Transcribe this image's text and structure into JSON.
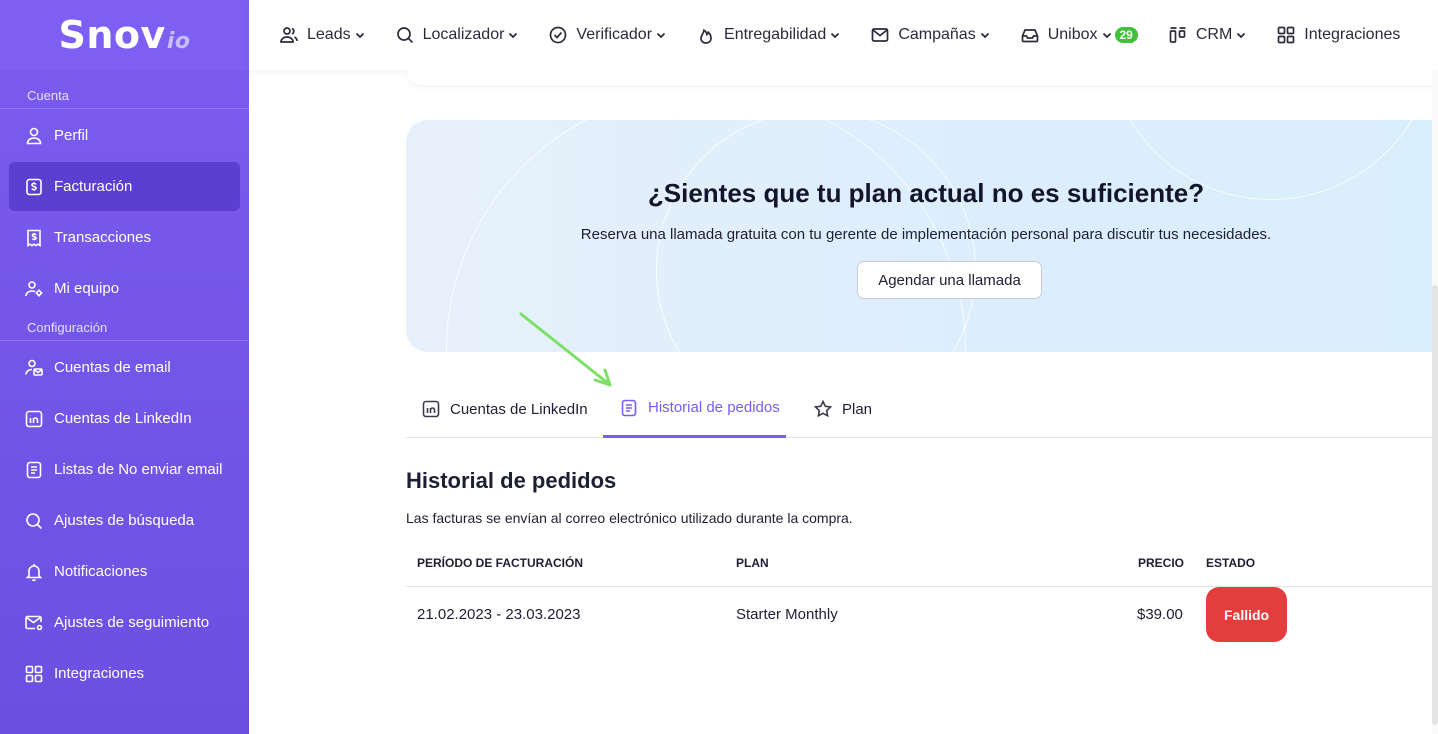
{
  "logo": {
    "main": "Snov",
    "suffix": "io"
  },
  "sidebar": {
    "section_account": "Cuenta",
    "section_config": "Configuración",
    "account_items": [
      {
        "label": "Perfil",
        "icon": "user-icon"
      },
      {
        "label": "Facturación",
        "icon": "dollar-card-icon",
        "active": true
      },
      {
        "label": "Transacciones",
        "icon": "receipt-icon"
      },
      {
        "label": "Mi equipo",
        "icon": "team-icon"
      }
    ],
    "config_items": [
      {
        "label": "Cuentas de email",
        "icon": "user-mail-icon"
      },
      {
        "label": "Cuentas de LinkedIn",
        "icon": "linkedin-icon"
      },
      {
        "label": "Listas de No enviar email",
        "icon": "list-doc-icon"
      },
      {
        "label": "Ajustes de búsqueda",
        "icon": "search-icon"
      },
      {
        "label": "Notificaciones",
        "icon": "bell-icon"
      },
      {
        "label": "Ajustes de seguimiento",
        "icon": "mail-settings-icon"
      },
      {
        "label": "Integraciones",
        "icon": "grid-icon"
      }
    ]
  },
  "topnav": {
    "items": [
      {
        "label": "Leads",
        "icon": "leads-icon"
      },
      {
        "label": "Localizador",
        "icon": "search-icon"
      },
      {
        "label": "Verificador",
        "icon": "check-circle-icon"
      },
      {
        "label": "Entregabilidad",
        "icon": "flame-icon"
      },
      {
        "label": "Campañas",
        "icon": "mail-icon"
      },
      {
        "label": "Unibox",
        "icon": "inbox-icon",
        "badge": "29"
      },
      {
        "label": "CRM",
        "icon": "crm-icon"
      },
      {
        "label": "Integraciones",
        "icon": "grid-icon"
      }
    ],
    "badge_color": "#3fc23a"
  },
  "banner": {
    "title": "¿Sientes que tu plan actual no es suficiente?",
    "subtitle": "Reserva una llamada gratuita con tu gerente de implementación personal para discutir tus necesidades.",
    "button": "Agendar una llamada"
  },
  "tabs": [
    {
      "label": "Cuentas de LinkedIn",
      "icon": "linkedin-icon"
    },
    {
      "label": "Historial de pedidos",
      "icon": "document-icon",
      "active": true
    },
    {
      "label": "Plan",
      "icon": "star-icon"
    }
  ],
  "orders": {
    "title": "Historial de pedidos",
    "subtitle": "Las facturas se envían al correo electrónico utilizado durante la compra.",
    "columns": [
      "PERÍODO DE FACTURACIÓN",
      "PLAN",
      "PRECIO",
      "ESTADO"
    ],
    "rows": [
      {
        "period": "21.02.2023 - 23.03.2023",
        "plan": "Starter Monthly",
        "price": "$39.00",
        "status": "Fallido"
      }
    ]
  },
  "colors": {
    "accent": "#7b5cf0",
    "status_failed": "#e43d3d",
    "annotation_arrow": "#7ee06a"
  }
}
